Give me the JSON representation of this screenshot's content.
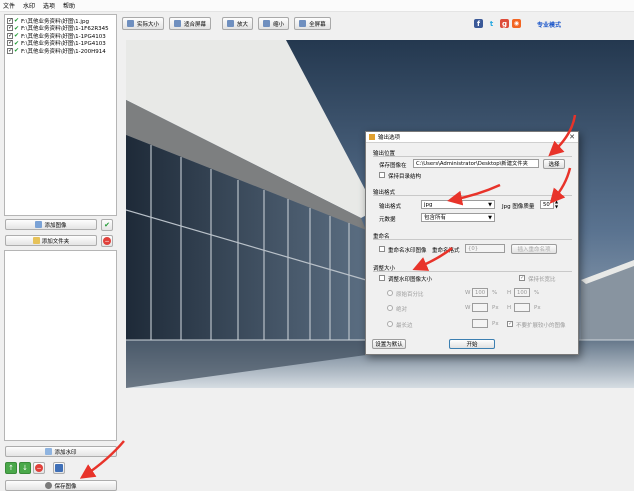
{
  "menu": [
    "文件",
    "水印",
    "选项",
    "帮助"
  ],
  "files": [
    "F:\\其他业务资料\\好图\\1.jpg",
    "F:\\其他业务资料\\好图\\1-1F62R345",
    "F:\\其他业务资料\\好图\\1-1PG4103",
    "F:\\其他业务资料\\好图\\1-1PG4103",
    "F:\\其他业务资料\\好图\\1-200H914"
  ],
  "left": {
    "add_image": "添加图像",
    "add_folder": "添加文件夹",
    "add_watermark": "添加水印",
    "save_image": "保存图像"
  },
  "toolbar": [
    "实际大小",
    "适合屏幕",
    "放大",
    "缩小",
    "全屏幕"
  ],
  "social": [
    {
      "icon": "facebook-icon",
      "glyph": "f",
      "color": "#3b5998"
    },
    {
      "icon": "twitter-icon",
      "glyph": "t",
      "color": "#29a9e1"
    },
    {
      "icon": "google-plus-icon",
      "glyph": "g",
      "color": "#dd4b39"
    },
    {
      "icon": "rss-icon",
      "glyph": "◉",
      "color": "#f26522"
    }
  ],
  "pro_mode": "专业模式",
  "dialog": {
    "title": "输出选项",
    "output_location": "输出位置",
    "save_to_label": "保存图像在",
    "save_path": "C:\\Users\\Administrator\\Desktop\\新建文件夹",
    "browse": "选择",
    "keep_dir": "保持目录结构",
    "output_format_section": "输出格式",
    "format_label": "输出格式",
    "format_value": "jpg",
    "quality_label": "Jpg 图像质量",
    "quality_value": "50",
    "metadata_label": "元数据",
    "metadata_value": "包含所有",
    "rename_section": "重命名",
    "rename_check": "重命名水印图像",
    "rename_format_label": "重命名格式",
    "rename_format_value": "{0}",
    "insert_rename_btn": "插入重命名项",
    "resize_section": "调整大小",
    "resize_check": "调整水印图像大小",
    "keep_ratio": "保持长宽比",
    "percent_label": "原始百分比",
    "w_label": "W",
    "h_label": "H",
    "percent_w": "100",
    "percent_h": "100",
    "percent_unit": "%",
    "absolute_label": "绝对",
    "px_unit": "Px",
    "longest_side_label": "最长边",
    "no_enlarge": "不要扩展较小的图像",
    "reset_btn": "设置为默认",
    "start_btn": "开始"
  },
  "colors": {
    "arrow": "#e8332a",
    "link": "#1a55c9"
  }
}
